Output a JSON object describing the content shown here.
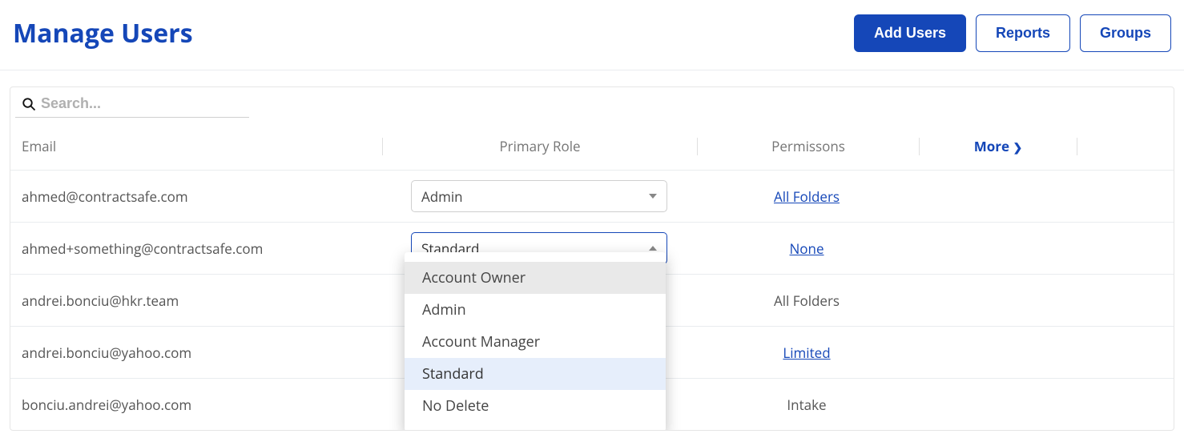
{
  "header": {
    "title": "Manage Users",
    "add_users_label": "Add Users",
    "reports_label": "Reports",
    "groups_label": "Groups"
  },
  "search": {
    "placeholder": "Search..."
  },
  "table": {
    "columns": {
      "email": "Email",
      "primary_role": "Primary Role",
      "permissions": "Permissons",
      "more": "More"
    }
  },
  "rows": [
    {
      "email": "ahmed@contractsafe.com",
      "role": "Admin",
      "role_open": false,
      "permission": "All Folders",
      "permission_style": "link"
    },
    {
      "email": "ahmed+something@contractsafe.com",
      "role": "Standard",
      "role_open": true,
      "permission": "None",
      "permission_style": "link"
    },
    {
      "email": "andrei.bonciu@hkr.team",
      "role": "",
      "role_open": false,
      "permission": "All Folders",
      "permission_style": "plain"
    },
    {
      "email": "andrei.bonciu@yahoo.com",
      "role": "",
      "role_open": false,
      "permission": "Limited",
      "permission_style": "link"
    },
    {
      "email": "bonciu.andrei@yahoo.com",
      "role": "",
      "role_open": false,
      "permission": "Intake",
      "permission_style": "plain"
    }
  ],
  "role_options": [
    {
      "label": "Account Owner",
      "state": "highlight"
    },
    {
      "label": "Admin",
      "state": ""
    },
    {
      "label": "Account Manager",
      "state": ""
    },
    {
      "label": "Standard",
      "state": "selected"
    },
    {
      "label": "No Delete",
      "state": ""
    }
  ]
}
